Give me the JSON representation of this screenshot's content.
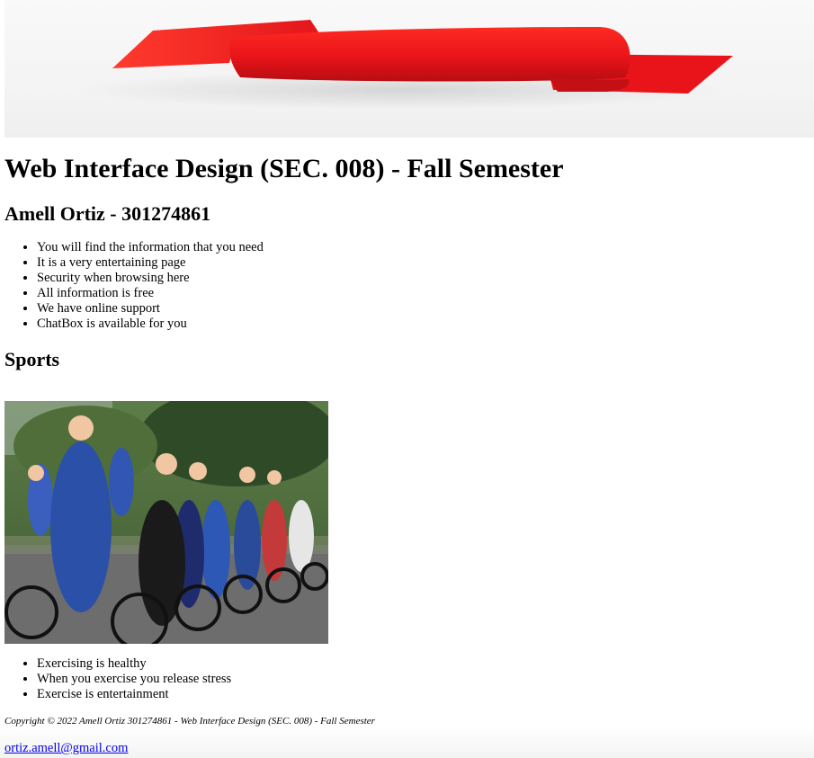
{
  "header": {
    "banner_icon": "red-ribbon-banner",
    "title": "Web Interface Design (SEC. 008) - Fall Semester",
    "subtitle": "Amell Ortiz - 301274861"
  },
  "features": [
    "You will find the information that you need",
    "It is a very entertaining page",
    "Security when browsing here",
    "All information is free",
    "We have online support",
    "ChatBox is available for you"
  ],
  "sports": {
    "heading": "Sports",
    "image_icon": "cyclists-racing-photo",
    "items": [
      "Exercising is healthy",
      "When you exercise you release stress",
      "Exercise is entertainment"
    ]
  },
  "footer": {
    "copyright": "Copyright © 2022 Amell Ortiz 301274861 - Web Interface Design (SEC. 008) - Fall Semester",
    "email": "ortiz.amell@gmail.com"
  },
  "colors": {
    "ribbon_red": "#e8141a",
    "link_blue": "#0000ee"
  }
}
